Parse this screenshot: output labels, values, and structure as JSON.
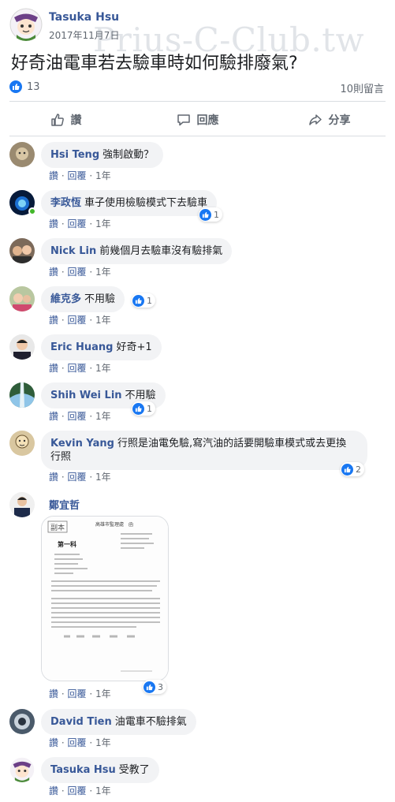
{
  "watermark": "Prius-C-Club.tw",
  "post": {
    "author": "Tasuka Hsu",
    "time": "2017年11月7日",
    "text": "好奇油電車若去驗車時如何驗排廢氣?",
    "reaction_count": "13",
    "comment_count": "10則留言"
  },
  "actions": {
    "like": "讚",
    "comment": "回應",
    "share": "分享"
  },
  "comment_meta": {
    "like": "讚",
    "reply": "回覆",
    "sep": "·",
    "age": "1年"
  },
  "comments": [
    {
      "name": "Hsi Teng",
      "text": "強制啟動？",
      "reactions": ""
    },
    {
      "name": "李政恆",
      "text": "車子使用檢驗模式下去驗車",
      "reactions": "1"
    },
    {
      "name": "Nick Lin",
      "text": "前幾個月去驗車沒有驗排氣",
      "reactions": ""
    },
    {
      "name": "維克多",
      "text": "不用驗",
      "reactions": "1"
    },
    {
      "name": "Eric Huang",
      "text": "好奇+1",
      "reactions": ""
    },
    {
      "name": "Shih Wei Lin",
      "text": "不用驗",
      "reactions": "1"
    },
    {
      "name": "Kevin Yang",
      "text": "行照是油電免驗,寫汽油的話要開驗車模式或去更換",
      "text2": "行照",
      "reactions": "2"
    },
    {
      "name": "鄭宜哲",
      "text": "",
      "reactions": "3"
    },
    {
      "name": "David Tien",
      "text": "油電車不驗排氣",
      "reactions": ""
    },
    {
      "name": "Tasuka Hsu",
      "text": "受教了",
      "reactions": ""
    }
  ],
  "document": {
    "header": "高雄市監理處　函",
    "stamp": "副本",
    "title": "第一科"
  },
  "colors": {
    "link": "#385898",
    "like_blue": "#1877f2",
    "bubble": "#f2f3f5",
    "meta": "#606770"
  }
}
